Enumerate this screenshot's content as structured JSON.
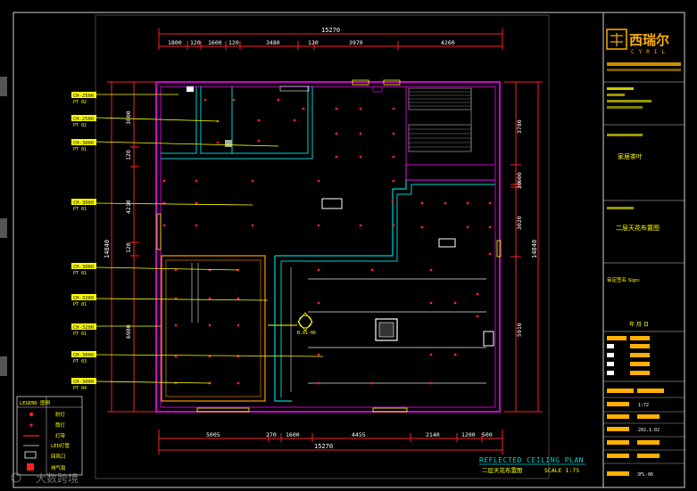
{
  "dimensions": {
    "top_total": "15270",
    "top_segments": [
      "1800",
      "120",
      "1600",
      "120",
      "3480",
      "120",
      "3970",
      "4260"
    ],
    "bottom_total": "15270",
    "bottom_segments": [
      "5005",
      "270",
      "1600",
      "4455",
      "2140",
      "1200",
      "500"
    ],
    "left_total": "14840",
    "left_segments": [
      "3800",
      "120",
      "4210",
      "120",
      "6980"
    ],
    "right_total": "14840",
    "right_segments": [
      "3780",
      "600",
      "30",
      "3020",
      "5910"
    ]
  },
  "ceiling_tags": [
    {
      "ch": "CH-2500",
      "pt": "PT 02"
    },
    {
      "ch": "CH-2500",
      "pt": "PT 02"
    },
    {
      "ch": "CH-3000",
      "pt": "PT 01"
    },
    {
      "ch": "CH-3000",
      "pt": "PT 01"
    },
    {
      "ch": "CH-3000",
      "pt": "PT 01"
    },
    {
      "ch": "CH-3200",
      "pt": "PT 01"
    },
    {
      "ch": "CH-3200",
      "pt": "PT 01"
    },
    {
      "ch": "CH-3000",
      "pt": "PT 03"
    },
    {
      "ch": "CH-3000",
      "pt": "PT 04"
    }
  ],
  "section_marker": "B.01-06",
  "legend": {
    "title": "LEGEND 图例",
    "items": [
      "射灯",
      "筒灯",
      "灯带",
      "LED灯管",
      "回风口",
      "排气扇"
    ]
  },
  "plan": {
    "title": "REFLECTED CEILING PLAN",
    "subtitle": "二层天花布置图",
    "scale": "SCALE 1:75"
  },
  "title_block": {
    "logo_cn": "西瑞尔",
    "logo_en": "CYRIL",
    "project": "家居茶叶",
    "drawing_name": "二层天花布置图",
    "sign_label": "审定签名 Sign:",
    "date_hint": "年 月 日",
    "scale_val": "1:72",
    "date_val": "202.1.02",
    "drawing_no": "3FL-06"
  },
  "watermark": "大数跨境",
  "colors": {
    "background": "#000000",
    "wall": "#d000d0",
    "dimension": "#ff2020",
    "text": "#ffff00",
    "cyan": "#00d0d0",
    "accent": "#ff9a00"
  }
}
